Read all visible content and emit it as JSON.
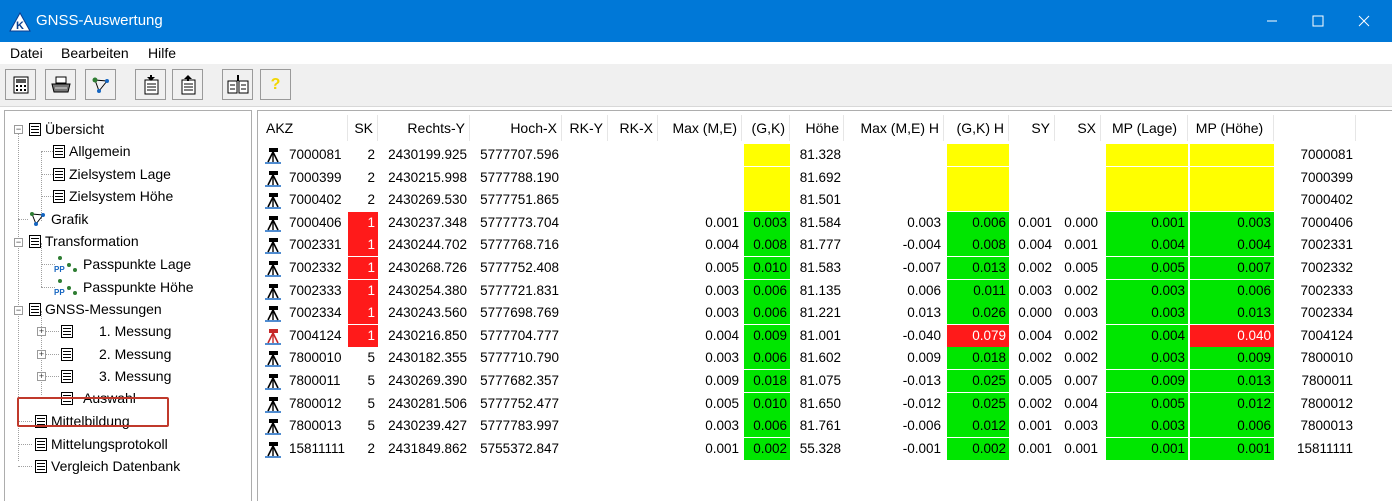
{
  "window": {
    "title": "GNSS-Auswertung",
    "app_icon_letter": "K"
  },
  "menu": [
    "Datei",
    "Bearbeiten",
    "Hilfe"
  ],
  "toolbar": {
    "help_glyph": "?"
  },
  "tree": {
    "nodes": [
      {
        "label": "Übersicht"
      },
      {
        "label": "Allgemein"
      },
      {
        "label": "Zielsystem Lage"
      },
      {
        "label": "Zielsystem Höhe"
      },
      {
        "label": "Grafik"
      },
      {
        "label": "Transformation"
      },
      {
        "label": "Passpunkte Lage"
      },
      {
        "label": "Passpunkte Höhe"
      },
      {
        "label": "GNSS-Messungen"
      },
      {
        "label": "1. Messung"
      },
      {
        "label": "2. Messung"
      },
      {
        "label": "3. Messung"
      },
      {
        "label": "Auswahl"
      },
      {
        "label": "Mittelbildung"
      },
      {
        "label": "Mittelungsprotokoll"
      },
      {
        "label": "Vergleich Datenbank"
      }
    ],
    "pp_badge": "PP"
  },
  "table": {
    "headers": [
      "AKZ",
      "SK",
      "Rechts-Y",
      "Hoch-X",
      "RK-Y",
      "RK-X",
      "Max (M,E)",
      "(G,K)",
      "Höhe",
      "Max (M,E) H",
      "(G,K) H",
      "SY",
      "SX",
      "MP (Lage)",
      "MP (Höhe)",
      ""
    ],
    "rows": [
      {
        "akz": "7000081",
        "sk": "2",
        "ry": "2430199.925",
        "hx": "5777707.596",
        "rky": "",
        "rkx": "",
        "max": "",
        "gk": "",
        "hoehe": "81.328",
        "maxh": "",
        "gkh": "",
        "sy": "",
        "sx": "",
        "mpl": "",
        "mph": "",
        "id": "7000081"
      },
      {
        "akz": "7000399",
        "sk": "2",
        "ry": "2430215.998",
        "hx": "5777788.190",
        "rky": "",
        "rkx": "",
        "max": "",
        "gk": "",
        "hoehe": "81.692",
        "maxh": "",
        "gkh": "",
        "sy": "",
        "sx": "",
        "mpl": "",
        "mph": "",
        "id": "7000399"
      },
      {
        "akz": "7000402",
        "sk": "2",
        "ry": "2430269.530",
        "hx": "5777751.865",
        "rky": "",
        "rkx": "",
        "max": "",
        "gk": "",
        "hoehe": "81.501",
        "maxh": "",
        "gkh": "",
        "sy": "",
        "sx": "",
        "mpl": "",
        "mph": "",
        "id": "7000402"
      },
      {
        "akz": "7000406",
        "sk": "1",
        "ry": "2430237.348",
        "hx": "5777773.704",
        "rky": "",
        "rkx": "",
        "max": "0.001",
        "gk": "0.003",
        "hoehe": "81.584",
        "maxh": "0.003",
        "gkh": "0.006",
        "sy": "0.001",
        "sx": "0.000",
        "mpl": "0.001",
        "mph": "0.003",
        "id": "7000406"
      },
      {
        "akz": "7002331",
        "sk": "1",
        "ry": "2430244.702",
        "hx": "5777768.716",
        "rky": "",
        "rkx": "",
        "max": "0.004",
        "gk": "0.008",
        "hoehe": "81.777",
        "maxh": "-0.004",
        "gkh": "0.008",
        "sy": "0.004",
        "sx": "0.001",
        "mpl": "0.004",
        "mph": "0.004",
        "id": "7002331"
      },
      {
        "akz": "7002332",
        "sk": "1",
        "ry": "2430268.726",
        "hx": "5777752.408",
        "rky": "",
        "rkx": "",
        "max": "0.005",
        "gk": "0.010",
        "hoehe": "81.583",
        "maxh": "-0.007",
        "gkh": "0.013",
        "sy": "0.002",
        "sx": "0.005",
        "mpl": "0.005",
        "mph": "0.007",
        "id": "7002332"
      },
      {
        "akz": "7002333",
        "sk": "1",
        "ry": "2430254.380",
        "hx": "5777721.831",
        "rky": "",
        "rkx": "",
        "max": "0.003",
        "gk": "0.006",
        "hoehe": "81.135",
        "maxh": "0.006",
        "gkh": "0.011",
        "sy": "0.003",
        "sx": "0.002",
        "mpl": "0.003",
        "mph": "0.006",
        "id": "7002333"
      },
      {
        "akz": "7002334",
        "sk": "1",
        "ry": "2430243.560",
        "hx": "5777698.769",
        "rky": "",
        "rkx": "",
        "max": "0.003",
        "gk": "0.006",
        "hoehe": "81.221",
        "maxh": "0.013",
        "gkh": "0.026",
        "sy": "0.000",
        "sx": "0.003",
        "mpl": "0.003",
        "mph": "0.013",
        "id": "7002334"
      },
      {
        "akz": "7004124",
        "sk": "1",
        "ry": "2430216.850",
        "hx": "5777704.777",
        "rky": "",
        "rkx": "",
        "max": "0.004",
        "gk": "0.009",
        "hoehe": "81.001",
        "maxh": "-0.040",
        "gkh": "0.079",
        "sy": "0.004",
        "sx": "0.002",
        "mpl": "0.004",
        "mph": "0.040",
        "id": "7004124"
      },
      {
        "akz": "7800010",
        "sk": "5",
        "ry": "2430182.355",
        "hx": "5777710.790",
        "rky": "",
        "rkx": "",
        "max": "0.003",
        "gk": "0.006",
        "hoehe": "81.602",
        "maxh": "0.009",
        "gkh": "0.018",
        "sy": "0.002",
        "sx": "0.002",
        "mpl": "0.003",
        "mph": "0.009",
        "id": "7800010"
      },
      {
        "akz": "7800011",
        "sk": "5",
        "ry": "2430269.390",
        "hx": "5777682.357",
        "rky": "",
        "rkx": "",
        "max": "0.009",
        "gk": "0.018",
        "hoehe": "81.075",
        "maxh": "-0.013",
        "gkh": "0.025",
        "sy": "0.005",
        "sx": "0.007",
        "mpl": "0.009",
        "mph": "0.013",
        "id": "7800011"
      },
      {
        "akz": "7800012",
        "sk": "5",
        "ry": "2430281.506",
        "hx": "5777752.477",
        "rky": "",
        "rkx": "",
        "max": "0.005",
        "gk": "0.010",
        "hoehe": "81.650",
        "maxh": "-0.012",
        "gkh": "0.025",
        "sy": "0.002",
        "sx": "0.004",
        "mpl": "0.005",
        "mph": "0.012",
        "id": "7800012"
      },
      {
        "akz": "7800013",
        "sk": "5",
        "ry": "2430239.427",
        "hx": "5777783.997",
        "rky": "",
        "rkx": "",
        "max": "0.003",
        "gk": "0.006",
        "hoehe": "81.761",
        "maxh": "-0.006",
        "gkh": "0.012",
        "sy": "0.001",
        "sx": "0.003",
        "mpl": "0.003",
        "mph": "0.006",
        "id": "7800013"
      },
      {
        "akz": "15811111",
        "sk": "2",
        "ry": "2431849.862",
        "hx": "5755372.847",
        "rky": "",
        "rkx": "",
        "max": "0.001",
        "gk": "0.002",
        "hoehe": "55.328",
        "maxh": "-0.001",
        "gkh": "0.002",
        "sy": "0.001",
        "sx": "0.001",
        "mpl": "0.001",
        "mph": "0.001",
        "id": "15811111"
      }
    ]
  },
  "colors": {
    "titlebar": "#0078d7",
    "highlight_ok": "#00e600",
    "highlight_missing": "#ffff00",
    "highlight_bad": "#ff1a1a"
  }
}
